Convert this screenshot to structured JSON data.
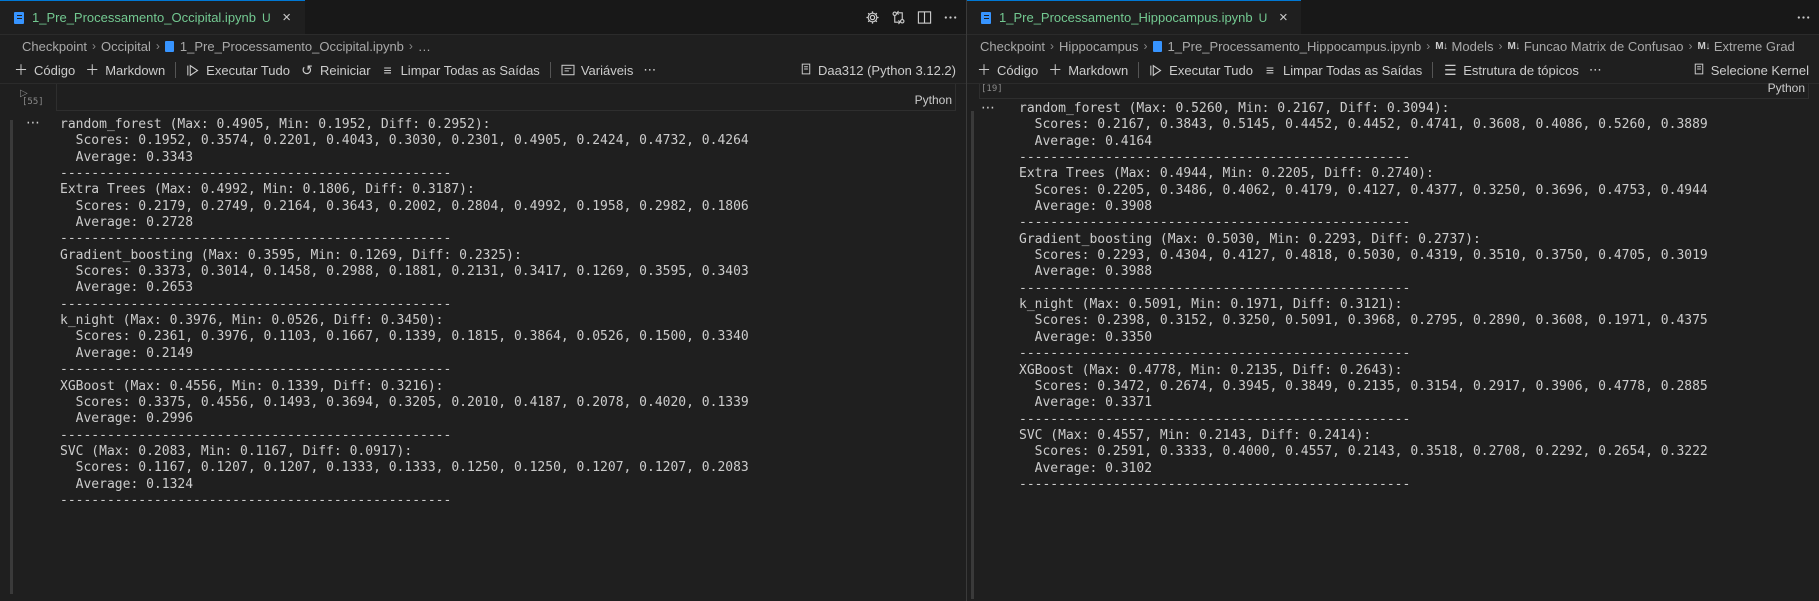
{
  "left": {
    "tab": {
      "title": "1_Pre_Processamento_Occipital.ipynb",
      "modified": "U",
      "close": "×"
    },
    "breadcrumb": [
      "Checkpoint",
      "Occipital",
      "1_Pre_Processamento_Occipital.ipynb",
      "…"
    ],
    "toolbar": {
      "code": "Código",
      "markdown": "Markdown",
      "run_all": "Executar Tudo",
      "restart": "Reiniciar",
      "clear_outputs": "Limpar Todas as Saídas",
      "variables": "Variáveis",
      "more": "⋯",
      "kernel": "Daa312 (Python 3.12.2)"
    },
    "cell": {
      "exec_count": "[55]",
      "language": "Python"
    },
    "output_ellipsis": "⋯",
    "output_lines": [
      "random_forest (Max: 0.4905, Min: 0.1952, Diff: 0.2952):",
      "  Scores: 0.1952, 0.3574, 0.2201, 0.4043, 0.3030, 0.2301, 0.4905, 0.2424, 0.4732, 0.4264",
      "  Average: 0.3343",
      "--------------------------------------------------",
      "Extra Trees (Max: 0.4992, Min: 0.1806, Diff: 0.3187):",
      "  Scores: 0.2179, 0.2749, 0.2164, 0.3643, 0.2002, 0.2804, 0.4992, 0.1958, 0.2982, 0.1806",
      "  Average: 0.2728",
      "--------------------------------------------------",
      "Gradient_boosting (Max: 0.3595, Min: 0.1269, Diff: 0.2325):",
      "  Scores: 0.3373, 0.3014, 0.1458, 0.2988, 0.1881, 0.2131, 0.3417, 0.1269, 0.3595, 0.3403",
      "  Average: 0.2653",
      "--------------------------------------------------",
      "k_night (Max: 0.3976, Min: 0.0526, Diff: 0.3450):",
      "  Scores: 0.2361, 0.3976, 0.1103, 0.1667, 0.1339, 0.1815, 0.3864, 0.0526, 0.1500, 0.3340",
      "  Average: 0.2149",
      "--------------------------------------------------",
      "XGBoost (Max: 0.4556, Min: 0.1339, Diff: 0.3216):",
      "  Scores: 0.3375, 0.4556, 0.1493, 0.3694, 0.3205, 0.2010, 0.4187, 0.2078, 0.4020, 0.1339",
      "  Average: 0.2996",
      "--------------------------------------------------",
      "SVC (Max: 0.2083, Min: 0.1167, Diff: 0.0917):",
      "  Scores: 0.1167, 0.1207, 0.1207, 0.1333, 0.1333, 0.1250, 0.1250, 0.1207, 0.1207, 0.2083",
      "  Average: 0.1324",
      "--------------------------------------------------"
    ]
  },
  "right": {
    "tab": {
      "title": "1_Pre_Processamento_Hippocampus.ipynb",
      "modified": "U",
      "close": "×"
    },
    "breadcrumb": [
      "Checkpoint",
      "Hippocampus",
      "1_Pre_Processamento_Hippocampus.ipynb",
      "Models",
      "Funcao Matrix de Confusao",
      "Extreme Grad"
    ],
    "toolbar": {
      "code": "Código",
      "markdown": "Markdown",
      "run_all": "Executar Tudo",
      "clear_outputs": "Limpar Todas as Saídas",
      "outline": "Estrutura de tópicos",
      "more": "⋯",
      "kernel": "Selecione Kernel"
    },
    "cell": {
      "exec_count": "[19]",
      "language": "Python"
    },
    "output_ellipsis": "⋯",
    "output_lines": [
      "random_forest (Max: 0.5260, Min: 0.2167, Diff: 0.3094):",
      "  Scores: 0.2167, 0.3843, 0.5145, 0.4452, 0.4452, 0.4741, 0.3608, 0.4086, 0.5260, 0.3889",
      "  Average: 0.4164",
      "--------------------------------------------------",
      "Extra Trees (Max: 0.4944, Min: 0.2205, Diff: 0.2740):",
      "  Scores: 0.2205, 0.3486, 0.4062, 0.4179, 0.4127, 0.4377, 0.3250, 0.3696, 0.4753, 0.4944",
      "  Average: 0.3908",
      "--------------------------------------------------",
      "Gradient_boosting (Max: 0.5030, Min: 0.2293, Diff: 0.2737):",
      "  Scores: 0.2293, 0.4304, 0.4127, 0.4818, 0.5030, 0.4319, 0.3510, 0.3750, 0.4705, 0.3019",
      "  Average: 0.3988",
      "--------------------------------------------------",
      "k_night (Max: 0.5091, Min: 0.1971, Diff: 0.3121):",
      "  Scores: 0.2398, 0.3152, 0.3250, 0.5091, 0.3968, 0.2795, 0.2890, 0.3608, 0.1971, 0.4375",
      "  Average: 0.3350",
      "--------------------------------------------------",
      "XGBoost (Max: 0.4778, Min: 0.2135, Diff: 0.2643):",
      "  Scores: 0.3472, 0.2674, 0.3945, 0.3849, 0.2135, 0.3154, 0.2917, 0.3906, 0.4778, 0.2885",
      "  Average: 0.3371",
      "--------------------------------------------------",
      "SVC (Max: 0.4557, Min: 0.2143, Diff: 0.2414):",
      "  Scores: 0.2591, 0.3333, 0.4000, 0.4557, 0.2143, 0.3518, 0.2708, 0.2292, 0.2654, 0.3222",
      "  Average: 0.3102",
      "--------------------------------------------------"
    ]
  },
  "colors": {
    "background": "#1f1f1f",
    "tab_title": "#73c991",
    "accent": "#0078d4",
    "text": "#cccccc"
  }
}
